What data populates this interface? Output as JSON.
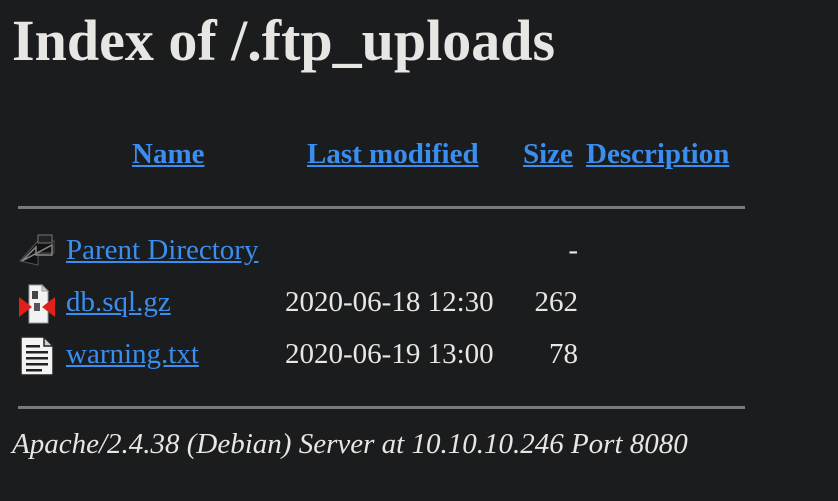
{
  "page": {
    "title": "Index of /.ftp_uploads"
  },
  "table": {
    "columns": {
      "name": "Name",
      "last_modified": "Last modified",
      "size": "Size",
      "description": "Description"
    },
    "rows": [
      {
        "name": "Parent Directory",
        "last_modified": "",
        "size": "-",
        "icon": "back-arrow-icon"
      },
      {
        "name": "db.sql.gz",
        "last_modified": "2020-06-18 12:30",
        "size": "262",
        "icon": "compressed-file-icon"
      },
      {
        "name": "warning.txt",
        "last_modified": "2020-06-19 13:00",
        "size": "78",
        "icon": "text-file-icon"
      }
    ]
  },
  "footer": {
    "signature": "Apache/2.4.38 (Debian) Server at 10.10.10.246 Port 8080"
  },
  "colors": {
    "background": "#1b1c1e",
    "text": "#e8e6e3",
    "link": "#3a8ef0"
  }
}
